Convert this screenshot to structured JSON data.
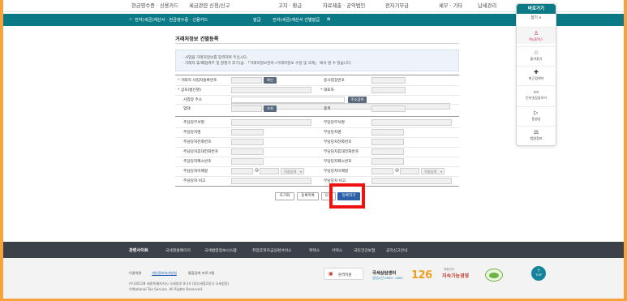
{
  "topnav": [
    "현금영수증 · 신용카드",
    "세금관련 신청/신고",
    "고지 · 환급",
    "자료제출 · 공익법인",
    "전자기부금",
    "세무 · 기타",
    "납세관리"
  ],
  "subnav": {
    "items": [
      "전자(세금)계산서 · 현금영수증 · 신용카드",
      "발급",
      "전자(세금)계산서 건별발급"
    ],
    "sep_glyph": "≡",
    "settings_glyph": "✿"
  },
  "page": {
    "title": "거래처정보 건별등록",
    "notice_lines": [
      "· 사업을 거래처정보를 입력하여 주십시오.",
      "· 거래처 휴/폐업여부 및 발행가 후기(급. 「거래처정보관리→거래처정보 수정 및 삭제」 에서 할 수 있습니다."
    ]
  },
  "form": {
    "biz_no_label": "거래처 사업자등록번호",
    "confirm_btn": "확인",
    "branch_label": "종사업장번호",
    "company_label": "상호(법인명)",
    "ceo_label": "대표자",
    "address_label": "사업장 주소",
    "address_search_btn": "주소검색",
    "biz_type_label": "업태",
    "type_search_btn": "조회",
    "biz_item_label": "종목",
    "dept_label": "주담당부서명",
    "dept2_label": "부담당부서명",
    "name_label": "주담당자명",
    "name2_label": "부담당자명",
    "phone_label": "주담당자전화번호",
    "phone2_label": "부담당자전화번호",
    "mobile_label": "주담당자휴대전화번호",
    "mobile2_label": "부담당자휴대전화번호",
    "fax_label": "주담당자팩스번호",
    "fax2_label": "부담당자팩스번호",
    "email_label": "주담당자이메일",
    "email2_label": "부담당자이메일",
    "email_at": "@",
    "email_domain_placeholder": "직접입력",
    "memo_label": "주담당자 비고",
    "memo2_label": "부담당자 비고"
  },
  "actions": {
    "reset": "초기화",
    "list": "등록목록",
    "close": "닫기",
    "register": "등록하기"
  },
  "quick": {
    "header": "바로가기",
    "fold": "접기 ∨",
    "items": [
      {
        "icon": "♙",
        "label": "My홈택스"
      },
      {
        "icon": "☆",
        "label": "즐겨찾기"
      },
      {
        "icon": "✚",
        "label": "최근검색어"
      },
      {
        "icon": "▭",
        "label": "인터넷상담하기"
      },
      {
        "icon": "▷",
        "label": "동영상"
      },
      {
        "icon": "⚖",
        "label": "법령정보"
      }
    ]
  },
  "footer": {
    "related_heading": "관련사이트",
    "related_links": [
      "국세청홈페이지",
      "국세법령정보시스템",
      "취업후학자금상환서비스",
      "위택스",
      "이택스",
      "국민건강보험",
      "공직신고안내"
    ],
    "privacy_label": "이용약관",
    "privacy_link": "개인정보처리방침",
    "terms_link": "통합검색 프로그램",
    "address": "(우)30128 세종특별자치시 국세청로 8-14 (정부세종2청사 국세청동)",
    "copyright": "©National Tax Service. All Rights Reserved.",
    "remote_support": "원격지원",
    "call_center_title": "국세상담센터",
    "call_center_hours": "상담시간 0900~1800",
    "call_center_number": "126",
    "integrity_top": "대한민국",
    "integrity": "지속가능경영",
    "top_button": "TOP"
  },
  "colors": {
    "accent": "#0b7a86",
    "highlight": "#ee1111",
    "primary_button": "#2c5fa8",
    "border_outer": "#f6a23d"
  }
}
